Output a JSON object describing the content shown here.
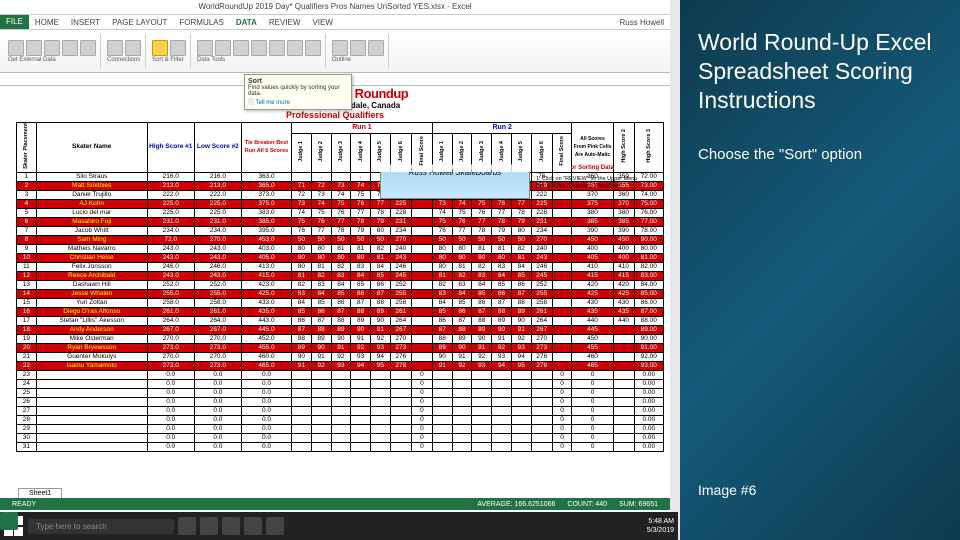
{
  "slide": {
    "title": "World Round-Up Excel Spreadsheet Scoring Instructions",
    "instruction": "Choose the \"Sort\" option",
    "image_label": "Image #6"
  },
  "excel": {
    "window_title": "WorldRoundUp 2019 Day* Qualifiers Pros Names UnSorted YES.xlsx - Excel",
    "tabs": [
      "FILE",
      "HOME",
      "INSERT",
      "PAGE LAYOUT",
      "FORMULAS",
      "DATA",
      "REVIEW",
      "VIEW"
    ],
    "active_tab": "DATA",
    "user": "Russ Howell",
    "ribbon_labels": {
      "ext": "Get External Data",
      "conn": "Connections",
      "sort": "Sort & Filter",
      "tools": "Data Tools",
      "outline": "Outline"
    },
    "tooltip": {
      "title": "Sort",
      "body": "Find values quickly by sorting your data.",
      "more": "Tell me more"
    },
    "sheet_title": "World Freestyle Roundup",
    "sheet_date": "May 17, 2019 • Cloverdale, Canada",
    "sheet_qual": "Professional Qualifiers",
    "logo": "Russ Howell SkateBoards",
    "directions": "And Allow For Sorting Data:",
    "steps": "1. Click on \"REVIEW\" on the Upper Menu Bar.\n2. Click \"Unprotect Worksheet\"",
    "status": {
      "ready": "READY",
      "avg": "AVERAGE: 166.6251066",
      "count": "COUNT: 440",
      "sum": "SUM: 69651"
    },
    "taskbar": {
      "search": "Type here to search",
      "time": "5:48 AM",
      "date": "5/3/2019"
    },
    "sheet_tab": "Sheet1",
    "headers": {
      "place": "Skater Placement",
      "name": "Skater Name",
      "hi": "High Score #1",
      "lo": "Low Score #2",
      "tie": "Tie Breaker Best Run All 6 Scores",
      "run1": "Run 1",
      "run2": "Run 2",
      "j1": "Judge 1",
      "j2": "Judge 2",
      "j3": "Judge 3",
      "j4": "Judge 4",
      "j5": "Judge 5",
      "j6": "Judge 6",
      "fs": "Final Score",
      "auto": "All Scores From Pink Cells Are Auto-Matic",
      "hs1": "High Score 1",
      "hs2": "High Score 2",
      "hs3": "High Score 3"
    },
    "rows": [
      {
        "p": 1,
        "n": "Silo Straus",
        "hi": "216.0",
        "lo": "216.0",
        "tb": "363.0",
        "r1": [
          "",
          ".",
          ".",
          ".",
          ".",
          ".",
          "216"
        ],
        "r2": [
          "70",
          "71",
          "72",
          "73",
          "74",
          "76",
          ""
        ],
        "s": [
          "360",
          "350",
          "72.00"
        ],
        "c": "w"
      },
      {
        "p": 2,
        "n": "Matt Smithies",
        "hi": "213.0",
        "lo": "213.0",
        "tb": "365.0",
        "r1": [
          "71",
          "72",
          "73",
          "74",
          "75",
          "219"
        ],
        "r2": [
          "71",
          "72",
          "73",
          "74",
          "75",
          "219"
        ],
        "s": [
          "365",
          "355",
          "73.00"
        ],
        "c": "r"
      },
      {
        "p": 3,
        "n": "Daniel Trujillo",
        "hi": "222.0",
        "lo": "222.0",
        "tb": "373.0",
        "r1": [
          "72",
          "73",
          "74",
          "75",
          "76",
          "222"
        ],
        "r2": [
          "72",
          "73",
          "74",
          "75",
          "76",
          "222"
        ],
        "s": [
          "370",
          "360",
          "74.00"
        ],
        "c": "w"
      },
      {
        "p": 4,
        "n": "AJ Kohn",
        "hi": "225.0",
        "lo": "225.0",
        "tb": "375.0",
        "r1": [
          "73",
          "74",
          "75",
          "76",
          "77",
          "225"
        ],
        "r2": [
          "73",
          "74",
          "75",
          "76",
          "77",
          "225"
        ],
        "s": [
          "375",
          "370",
          "75.00"
        ],
        "c": "r"
      },
      {
        "p": 5,
        "n": "Lucio del mar",
        "hi": "225.0",
        "lo": "225.0",
        "tb": "383.0",
        "r1": [
          "74",
          "75",
          "76",
          "77",
          "78",
          "228"
        ],
        "r2": [
          "74",
          "75",
          "76",
          "77",
          "78",
          "228"
        ],
        "s": [
          "380",
          "380",
          "76.00"
        ],
        "c": "w"
      },
      {
        "p": 6,
        "n": "Masahiro Fuji",
        "hi": "231.0",
        "lo": "231.0",
        "tb": "385.0",
        "r1": [
          "75",
          "76",
          "77",
          "78",
          "79",
          "231"
        ],
        "r2": [
          "75",
          "76",
          "77",
          "78",
          "79",
          "231"
        ],
        "s": [
          "385",
          "385",
          "77.00"
        ],
        "c": "r"
      },
      {
        "p": 7,
        "n": "Jacob Whitt",
        "hi": "234.0",
        "lo": "234.0",
        "tb": "395.0",
        "r1": [
          "76",
          "77",
          "78",
          "79",
          "80",
          "234"
        ],
        "r2": [
          "76",
          "77",
          "78",
          "79",
          "80",
          "234"
        ],
        "s": [
          "390",
          "390",
          "78.00"
        ],
        "c": "w"
      },
      {
        "p": 8,
        "n": "Sam Ming",
        "hi": "72.0",
        "lo": "270.0",
        "tb": "453.0",
        "r1": [
          "50",
          "50",
          "50",
          "50",
          "50",
          "270"
        ],
        "r2": [
          "50",
          "50",
          "50",
          "50",
          "50",
          "270"
        ],
        "s": [
          "450",
          "450",
          "90.00"
        ],
        "c": "r"
      },
      {
        "p": 9,
        "n": "Matheis Navarro",
        "hi": "243.0",
        "lo": "243.0",
        "tb": "403.0",
        "r1": [
          "80",
          "80",
          "81",
          "81",
          "82",
          "240"
        ],
        "r2": [
          "80",
          "80",
          "81",
          "81",
          "82",
          "240"
        ],
        "s": [
          "400",
          "400",
          "80.00"
        ],
        "c": "w"
      },
      {
        "p": 10,
        "n": "Christian Heise",
        "hi": "243.0",
        "lo": "243.0",
        "tb": "405.0",
        "r1": [
          "80",
          "80",
          "80",
          "80",
          "81",
          "243"
        ],
        "r2": [
          "80",
          "80",
          "80",
          "80",
          "81",
          "243"
        ],
        "s": [
          "405",
          "400",
          "81.00"
        ],
        "c": "r"
      },
      {
        "p": 11,
        "n": "Felix Jonsson",
        "hi": "246.0",
        "lo": "246.0",
        "tb": "413.0",
        "r1": [
          "80",
          "81",
          "82",
          "83",
          "84",
          "246"
        ],
        "r2": [
          "80",
          "81",
          "82",
          "83",
          "84",
          "246"
        ],
        "s": [
          "410",
          "410",
          "82.00"
        ],
        "c": "w"
      },
      {
        "p": 12,
        "n": "Reece Archibald",
        "hi": "243.0",
        "lo": "243.0",
        "tb": "415.0",
        "r1": [
          "81",
          "82",
          "83",
          "84",
          "85",
          "245"
        ],
        "r2": [
          "81",
          "82",
          "83",
          "84",
          "85",
          "245"
        ],
        "s": [
          "415",
          "415",
          "83.00"
        ],
        "c": "r"
      },
      {
        "p": 13,
        "n": "Dashawn Hill",
        "hi": "252.0",
        "lo": "252.0",
        "tb": "423.0",
        "r1": [
          "82",
          "83",
          "84",
          "85",
          "86",
          "252"
        ],
        "r2": [
          "82",
          "83",
          "84",
          "85",
          "86",
          "252"
        ],
        "s": [
          "420",
          "420",
          "84.00"
        ],
        "c": "w"
      },
      {
        "p": 14,
        "n": "Jesse Whalen",
        "hi": "255.0",
        "lo": "255.0",
        "tb": "425.0",
        "r1": [
          "83",
          "84",
          "85",
          "86",
          "87",
          "255"
        ],
        "r2": [
          "83",
          "84",
          "85",
          "86",
          "87",
          "255"
        ],
        "s": [
          "425",
          "425",
          "85.00"
        ],
        "c": "r"
      },
      {
        "p": 15,
        "n": "Yuri Zoltan",
        "hi": "258.0",
        "lo": "258.0",
        "tb": "433.0",
        "r1": [
          "84",
          "85",
          "86",
          "87",
          "88",
          "258"
        ],
        "r2": [
          "84",
          "85",
          "86",
          "87",
          "88",
          "258"
        ],
        "s": [
          "430",
          "430",
          "86.00"
        ],
        "c": "w"
      },
      {
        "p": 16,
        "n": "Diego D'ras Alfonso",
        "hi": "261.0",
        "lo": "261.0",
        "tb": "435.0",
        "r1": [
          "85",
          "86",
          "87",
          "88",
          "89",
          "261"
        ],
        "r2": [
          "85",
          "86",
          "87",
          "88",
          "89",
          "261"
        ],
        "s": [
          "435",
          "435",
          "87.00"
        ],
        "c": "r"
      },
      {
        "p": 17,
        "n": "Stefan \"Lillis\" Åkesson",
        "hi": "264.0",
        "lo": "264.0",
        "tb": "443.0",
        "r1": [
          "86",
          "87",
          "88",
          "89",
          "90",
          "264"
        ],
        "r2": [
          "86",
          "87",
          "88",
          "89",
          "90",
          "264"
        ],
        "s": [
          "440",
          "440",
          "88.00"
        ],
        "c": "w"
      },
      {
        "p": 18,
        "n": "Andy Anderson",
        "hi": "267.0",
        "lo": "267.0",
        "tb": "445.0",
        "r1": [
          "87",
          "88",
          "89",
          "90",
          "91",
          "267"
        ],
        "r2": [
          "87",
          "88",
          "89",
          "90",
          "91",
          "267"
        ],
        "s": [
          "445",
          "",
          "89.00"
        ],
        "c": "r"
      },
      {
        "p": 19,
        "n": "Mike Osterman",
        "hi": "270.0",
        "lo": "270.0",
        "tb": "452.0",
        "r1": [
          "88",
          "89",
          "90",
          "91",
          "92",
          "270"
        ],
        "r2": [
          "88",
          "89",
          "90",
          "91",
          "92",
          "270"
        ],
        "s": [
          "450",
          "",
          "90.00"
        ],
        "c": "w"
      },
      {
        "p": 20,
        "n": "Ryan Bryewsson",
        "hi": "273.0",
        "lo": "273.0",
        "tb": "455.0",
        "r1": [
          "89",
          "90",
          "91",
          "92",
          "93",
          "273"
        ],
        "r2": [
          "89",
          "90",
          "91",
          "92",
          "93",
          "273"
        ],
        "s": [
          "455",
          "",
          "91.00"
        ],
        "c": "r"
      },
      {
        "p": 21,
        "n": "Guenter Mokulys",
        "hi": "270.0",
        "lo": "270.0",
        "tb": "460.0",
        "r1": [
          "90",
          "91",
          "92",
          "93",
          "94",
          "276"
        ],
        "r2": [
          "90",
          "91",
          "92",
          "93",
          "94",
          "276"
        ],
        "s": [
          "460",
          "",
          "92.00"
        ],
        "c": "w"
      },
      {
        "p": 22,
        "n": "Isamu Yamamoto",
        "hi": "273.0",
        "lo": "273.0",
        "tb": "465.0",
        "r1": [
          "91",
          "92",
          "93",
          "94",
          "95",
          "278"
        ],
        "r2": [
          "91",
          "92",
          "93",
          "94",
          "95",
          "278"
        ],
        "s": [
          "465",
          "",
          "93.00"
        ],
        "c": "r"
      }
    ],
    "empty_rows": 9
  }
}
